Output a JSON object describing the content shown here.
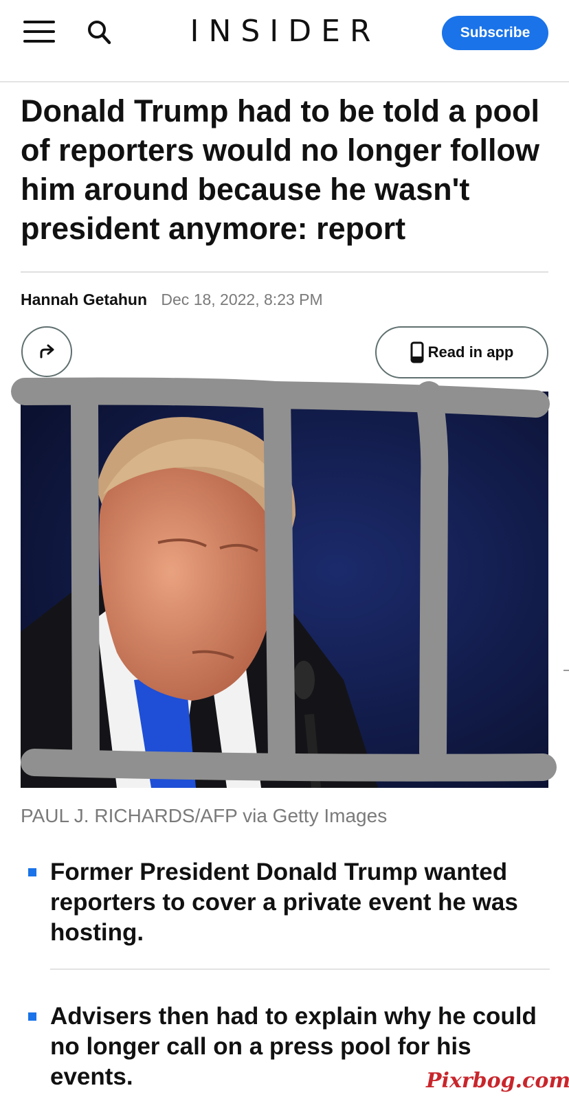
{
  "header": {
    "logo": "INSIDER",
    "subscribe_label": "Subscribe"
  },
  "article": {
    "headline": "Donald Trump had to be told a pool of reporters would no longer follow him around because he wasn't president anymore: report",
    "author": "Hannah Getahun",
    "date": "Dec 18, 2022, 8:23 PM",
    "read_in_app_label": "Read in app",
    "photo_credit": "PAUL J. RICHARDS/AFP via Getty Images",
    "bullets": [
      "Former President Donald Trump wanted reporters to cover a private event he was hosting.",
      "Advisers then had to explain why he could no longer call on a press pool for his events."
    ]
  },
  "watermark": "Pixrbog.com",
  "colors": {
    "accent": "#1a73e8",
    "watermark": "#c8262c",
    "marker_overlay": "#909090"
  },
  "icons": [
    "menu-icon",
    "search-icon",
    "share-icon",
    "phone-icon"
  ]
}
